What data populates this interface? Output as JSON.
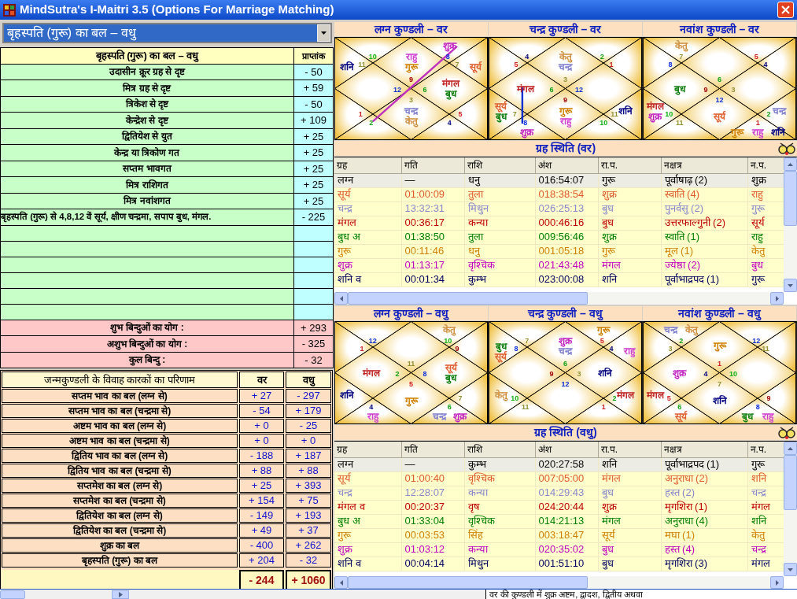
{
  "window": {
    "title": "MindSutra's I-Maitri 3.5 (Options For Marriage Matching)"
  },
  "selector": {
    "value": "बृहस्पति (गुरू) का बल – वधु"
  },
  "strength_table": {
    "title": "बृहस्पति (गुरू) का बल – वधु",
    "value_header": "प्राप्तांक",
    "rows": [
      {
        "kind": "score",
        "label": "उदासीन क्रूर ग्रह से दृष्ट",
        "value": "- 50"
      },
      {
        "kind": "score",
        "label": "मित्र ग्रह से दृष्ट",
        "value": "+ 59"
      },
      {
        "kind": "score",
        "label": "त्रिकेश से दृष्ट",
        "value": "- 50"
      },
      {
        "kind": "score",
        "label": "केन्द्रेश से दृष्ट",
        "value": "+ 109"
      },
      {
        "kind": "score",
        "label": "द्वितियेश से युत",
        "value": "+ 25"
      },
      {
        "kind": "score",
        "label": "केन्द्र या त्रिकोण गत",
        "value": "+ 25"
      },
      {
        "kind": "score",
        "label": "सप्तम भावगत",
        "value": "+ 25"
      },
      {
        "kind": "score",
        "label": "मित्र राशिगत",
        "value": "+ 25"
      },
      {
        "kind": "score",
        "label": "मित्र नवांशगत",
        "value": "+ 25"
      },
      {
        "kind": "score",
        "label": "बृहस्पति (गुरू) से 4,8,12 वें सूर्य, क्षीण चन्द्रमा, सपाप बुध, मंगल.",
        "value": "- 225"
      },
      {
        "kind": "blank"
      },
      {
        "kind": "blank"
      },
      {
        "kind": "blank"
      },
      {
        "kind": "blank"
      },
      {
        "kind": "blank"
      },
      {
        "kind": "blank"
      },
      {
        "kind": "summary",
        "label": "शुभ बिन्दुओं का योग :",
        "value": "+ 293"
      },
      {
        "kind": "summary",
        "label": "अशुभ बिन्दुओं का योग :",
        "value": "- 325"
      },
      {
        "kind": "summary",
        "label": "कुल बिन्दु :",
        "value": "- 32"
      }
    ]
  },
  "result_table": {
    "columns": [
      "जन्मकुण्डली के विवाह कारकों का परिणाम",
      "वर",
      "वधु"
    ],
    "rows": [
      {
        "label": "सप्तम भाव का बल (लग्न से)",
        "var": "+ 27",
        "vadhu": "- 297"
      },
      {
        "label": "सप्तम भाव का बल (चन्द्रमा से)",
        "var": "- 54",
        "vadhu": "+ 179"
      },
      {
        "label": "अष्टम भाव का बल (लग्न से)",
        "var": "+ 0",
        "vadhu": "- 25"
      },
      {
        "label": "अष्टम भाव का बल (चन्द्रमा से)",
        "var": "+ 0",
        "vadhu": "+ 0"
      },
      {
        "label": "द्वितिय भाव का बल (लग्न से)",
        "var": "- 188",
        "vadhu": "+ 187"
      },
      {
        "label": "द्वितिय भाव का बल (चन्द्रमा से)",
        "var": "+ 88",
        "vadhu": "+ 88"
      },
      {
        "label": "सप्तमेश का बल (लग्न से)",
        "var": "+ 25",
        "vadhu": "+ 393"
      },
      {
        "label": "सप्तमेश का बल (चन्द्रमा से)",
        "var": "+ 154",
        "vadhu": "+ 75"
      },
      {
        "label": "द्वितियेश का बल (लग्न से)",
        "var": "- 149",
        "vadhu": "+ 193"
      },
      {
        "label": "द्वितियेश का बल (चन्द्रमा से)",
        "var": "+ 49",
        "vadhu": "+ 37"
      },
      {
        "label": "शुक्र का बल",
        "var": "- 400",
        "vadhu": "+ 262"
      },
      {
        "label": "बृहस्पति (गुरू) का बल",
        "var": "+ 204",
        "vadhu": "- 32"
      }
    ],
    "totals": [
      "- 244",
      "+ 1060"
    ]
  },
  "var": {
    "charts": [
      {
        "title": "लग्न कुण्डली – वर",
        "aspect_line": {
          "color": "#c030c0"
        },
        "houses": {
          "top_left": {
            "sign": "10"
          },
          "top_right": {
            "sign": "8",
            "planets": [
              {
                "name": "शुक्र",
                "color": "#c020c0"
              }
            ]
          },
          "top": {
            "sign": "9",
            "planets": [
              {
                "name": "राहु",
                "color": "#d040d0"
              },
              {
                "name": "गुरू",
                "color": "#d08000"
              }
            ]
          },
          "left_top": {
            "sign": "11",
            "planets": [
              {
                "name": "शनि",
                "color": "#000080"
              }
            ]
          },
          "right_top": {
            "sign": "7",
            "planets": [
              {
                "name": "सूर्य",
                "color": "#e06030"
              }
            ]
          },
          "left": {
            "sign": "12"
          },
          "right": {
            "sign": "6",
            "planets": [
              {
                "name": "मंगल",
                "color": "#c02020"
              },
              {
                "name": "बुध",
                "color": "#108010"
              }
            ]
          },
          "left_bottom": {
            "sign": "1"
          },
          "right_bottom": {
            "sign": "5"
          },
          "bottom": {
            "sign": "3",
            "planets": [
              {
                "name": "चन्द्र",
                "color": "#8080d0"
              },
              {
                "name": "केतु",
                "color": "#d09040"
              }
            ]
          },
          "bottom_left": {
            "sign": "2"
          },
          "bottom_right": {
            "sign": "4"
          }
        }
      },
      {
        "title": "चन्द्र कुण्डली – वर",
        "aspect_line": {
          "color": "#1030d0"
        },
        "houses": {
          "top_left": {
            "sign": "4"
          },
          "top_right": {
            "sign": "2"
          },
          "top": {
            "sign": "3",
            "planets": [
              {
                "name": "केतु",
                "color": "#d09040"
              },
              {
                "name": "चन्द्र",
                "color": "#8080d0"
              }
            ]
          },
          "left_top": {
            "sign": "5"
          },
          "right_top": {
            "sign": "1"
          },
          "left": {
            "sign": "6",
            "planets": [
              {
                "name": "मंगल",
                "color": "#c02020"
              }
            ]
          },
          "right": {
            "sign": "12"
          },
          "left_bottom": {
            "sign": "7",
            "planets": [
              {
                "name": "सूर्य",
                "color": "#e06030"
              },
              {
                "name": "बुध",
                "color": "#108010"
              }
            ]
          },
          "right_bottom": {
            "sign": "11",
            "planets": [
              {
                "name": "शनि",
                "color": "#000080"
              }
            ]
          },
          "bottom": {
            "sign": "9",
            "planets": [
              {
                "name": "गुरू",
                "color": "#d08000"
              },
              {
                "name": "राहु",
                "color": "#d040d0"
              }
            ]
          },
          "bottom_left": {
            "sign": "8",
            "planets": [
              {
                "name": "शुक्र",
                "color": "#c020c0"
              }
            ]
          },
          "bottom_right": {
            "sign": "10"
          }
        }
      },
      {
        "title": "नवांश कुण्डली – वर",
        "houses": {
          "top_left": {
            "sign": "7",
            "planets": [
              {
                "name": "केतु",
                "color": "#d09040"
              }
            ]
          },
          "top_right": {
            "sign": "5"
          },
          "top": {
            "sign": "6"
          },
          "left_top": {
            "sign": "8"
          },
          "right_top": {
            "sign": "4"
          },
          "left": {
            "sign": "9",
            "planets": [
              {
                "name": "बुध",
                "color": "#108010"
              }
            ]
          },
          "right": {
            "sign": "3"
          },
          "left_bottom": {
            "sign": "10",
            "planets": [
              {
                "name": "मंगल",
                "color": "#c02020"
              },
              {
                "name": "शुक्र",
                "color": "#c020c0"
              }
            ]
          },
          "right_bottom": {
            "sign": "2",
            "planets": [
              {
                "name": "चन्द्र",
                "color": "#8080d0"
              }
            ]
          },
          "bottom": {
            "sign": "12",
            "planets": [
              {
                "name": "सूर्य",
                "color": "#e06030"
              }
            ]
          },
          "bottom_left": {
            "sign": "11"
          },
          "bottom_right": {
            "sign": "1",
            "planets": [
              {
                "name": "गुरू",
                "color": "#d08000"
              },
              {
                "name": "राहु",
                "color": "#d040d0"
              },
              {
                "name": "शनि",
                "color": "#000080"
              }
            ]
          }
        }
      }
    ],
    "positions": {
      "title": "ग्रह स्थिति (वर)",
      "columns": [
        "ग्रह",
        "गति",
        "राशि",
        "अंश",
        "रा.प.",
        "नक्षत्र",
        "न.प."
      ],
      "rows": [
        {
          "kind": "lagna",
          "color": "#000000",
          "cells": [
            "लग्न",
            "—",
            "धनु",
            "016:54:07",
            "गुरू",
            "पूर्वाषाढ़ (2)",
            "शुक्र"
          ]
        },
        {
          "kind": "planet",
          "color": "#e05a2a",
          "cells": [
            "सूर्य",
            "01:00:09",
            "तुला",
            "018:38:54",
            "शुक्र",
            "स्वाति (4)",
            "राहु"
          ]
        },
        {
          "kind": "planet",
          "color": "#8888cc",
          "cells": [
            "चन्द्र",
            "13:32:31",
            "मिथुन",
            "026:25:13",
            "बुध",
            "पुनर्वसु (2)",
            "गुरू"
          ]
        },
        {
          "kind": "planet",
          "color": "#c00000",
          "cells": [
            "मंगल",
            "00:36:17",
            "कन्या",
            "000:46:16",
            "बुध",
            "उत्तरफाल्गुनी (2)",
            "सूर्य"
          ]
        },
        {
          "kind": "planet",
          "color": "#008000",
          "cells": [
            "बुध अ",
            "01:38:50",
            "तुला",
            "009:56:46",
            "शुक्र",
            "स्वाति (1)",
            "राहु"
          ]
        },
        {
          "kind": "planet",
          "color": "#d08000",
          "cells": [
            "गुरू",
            "00:11:46",
            "धनु",
            "001:05:18",
            "गुरू",
            "मूल (1)",
            "केतु"
          ]
        },
        {
          "kind": "planet",
          "color": "#c000c0",
          "cells": [
            "शुक्र",
            "01:13:17",
            "वृश्चिक",
            "021:43:48",
            "मंगल",
            "ज्येष्ठा (2)",
            "बुध"
          ]
        },
        {
          "kind": "planet",
          "color": "#000060",
          "cells": [
            "शनि व",
            "00:01:34",
            "कुम्भ",
            "023:00:08",
            "शनि",
            "पूर्वाभाद्रपद (1)",
            "गुरू"
          ]
        }
      ]
    }
  },
  "vadhu": {
    "charts": [
      {
        "title": "लग्न कुण्डली – वधु",
        "houses": {
          "top_left": {
            "sign": "12"
          },
          "top_right": {
            "sign": "10",
            "planets": [
              {
                "name": "केतु",
                "color": "#d09040"
              }
            ]
          },
          "top": {
            "sign": "11"
          },
          "left_top": {
            "sign": "1"
          },
          "right_top": {
            "sign": "9"
          },
          "left": {
            "sign": "2",
            "planets": [
              {
                "name": "मंगल",
                "color": "#c02020"
              }
            ]
          },
          "right": {
            "sign": "8",
            "planets": [
              {
                "name": "सूर्य",
                "color": "#e06030"
              },
              {
                "name": "बुध",
                "color": "#108010"
              }
            ]
          },
          "left_bottom": {
            "planets": [
              {
                "name": "शनि",
                "color": "#000080"
              }
            ]
          },
          "right_bottom": {
            "sign": "7"
          },
          "bottom": {
            "sign": "5",
            "planets": [
              {
                "name": "गुरू",
                "color": "#d08000"
              }
            ]
          },
          "bottom_left": {
            "sign": "4",
            "planets": [
              {
                "name": "राहु",
                "color": "#d040d0"
              }
            ]
          },
          "bottom_right": {
            "sign": "6",
            "planets": [
              {
                "name": "चन्द्र",
                "color": "#8080d0"
              },
              {
                "name": "शुक्र",
                "color": "#c020c0"
              }
            ]
          }
        }
      },
      {
        "title": "चन्द्र कुण्डली – वधु",
        "houses": {
          "top_left": {
            "sign": "7"
          },
          "top_right": {
            "sign": "5",
            "planets": [
              {
                "name": "गुरू",
                "color": "#d08000"
              }
            ]
          },
          "top": {
            "sign": "6",
            "planets": [
              {
                "name": "शुक्र",
                "color": "#c020c0"
              },
              {
                "name": "चन्द्र",
                "color": "#8080d0"
              }
            ]
          },
          "left_top": {
            "sign": "8",
            "planets": [
              {
                "name": "बुध",
                "color": "#108010"
              },
              {
                "name": "सूर्य",
                "color": "#e06030"
              }
            ]
          },
          "right_top": {
            "sign": "4",
            "planets": [
              {
                "name": "राहु",
                "color": "#d040d0"
              }
            ]
          },
          "left": {
            "sign": "9"
          },
          "right": {
            "sign": "3",
            "planets": [
              {
                "name": "शनि",
                "color": "#000080"
              }
            ]
          },
          "left_bottom": {
            "sign": "10",
            "planets": [
              {
                "name": "केतु",
                "color": "#d09040"
              }
            ]
          },
          "right_bottom": {
            "sign": "2",
            "planets": [
              {
                "name": "मंगल",
                "color": "#c02020"
              }
            ]
          },
          "bottom": {
            "sign": "12"
          },
          "bottom_left": {
            "sign": "11"
          },
          "bottom_right": {
            "sign": "1"
          }
        }
      },
      {
        "title": "नवांश कुण्डली – वधु",
        "houses": {
          "top_left": {
            "sign": "2",
            "planets": [
              {
                "name": "चन्द्र",
                "color": "#8080d0"
              },
              {
                "name": "केतु",
                "color": "#d09040"
              }
            ]
          },
          "top_right": {
            "sign": "12"
          },
          "top": {
            "sign": "1",
            "planets": [
              {
                "name": "गुरू",
                "color": "#d08000"
              }
            ]
          },
          "left_top": {
            "sign": "3"
          },
          "right_top": {
            "sign": "11"
          },
          "left": {
            "sign": "4",
            "planets": [
              {
                "name": "शुक्र",
                "color": "#c020c0"
              }
            ]
          },
          "right": {
            "sign": "10"
          },
          "left_bottom": {
            "sign": "5",
            "planets": [
              {
                "name": "मंगल",
                "color": "#c02020"
              }
            ]
          },
          "right_bottom": {
            "sign": "9"
          },
          "bottom": {
            "sign": "7",
            "planets": [
              {
                "name": "शनि",
                "color": "#000080"
              }
            ]
          },
          "bottom_left": {
            "sign": "6",
            "planets": [
              {
                "name": "सूर्य",
                "color": "#e06030"
              }
            ]
          },
          "bottom_right": {
            "sign": "8",
            "planets": [
              {
                "name": "बुध",
                "color": "#108010"
              },
              {
                "name": "राहु",
                "color": "#d040d0"
              }
            ]
          }
        }
      }
    ],
    "positions": {
      "title": "ग्रह स्थिति (वधु)",
      "columns": [
        "ग्रह",
        "गति",
        "राशि",
        "अंश",
        "रा.प.",
        "नक्षत्र",
        "न.प."
      ],
      "rows": [
        {
          "kind": "lagna",
          "color": "#000000",
          "cells": [
            "लग्न",
            "—",
            "कुम्भ",
            "020:27:58",
            "शनि",
            "पूर्वाभाद्रपद (1)",
            "गुरू"
          ]
        },
        {
          "kind": "planet",
          "color": "#e05a2a",
          "cells": [
            "सूर्य",
            "01:00:40",
            "वृश्चिक",
            "007:05:00",
            "मंगल",
            "अनुराधा (2)",
            "शनि"
          ]
        },
        {
          "kind": "planet",
          "color": "#8888cc",
          "cells": [
            "चन्द्र",
            "12:28:07",
            "कन्या",
            "014:29:43",
            "बुध",
            "हस्त (2)",
            "चन्द्र"
          ]
        },
        {
          "kind": "planet",
          "color": "#c00000",
          "cells": [
            "मंगल व",
            "00:20:37",
            "वृष",
            "024:20:44",
            "शुक्र",
            "मृगशिरा (1)",
            "मंगल"
          ]
        },
        {
          "kind": "planet",
          "color": "#008000",
          "cells": [
            "बुध अ",
            "01:33:04",
            "वृश्चिक",
            "014:21:13",
            "मंगल",
            "अनुराधा (4)",
            "शनि"
          ]
        },
        {
          "kind": "planet",
          "color": "#d08000",
          "cells": [
            "गुरू",
            "00:03:53",
            "सिंह",
            "003:18:47",
            "सूर्य",
            "मघा (1)",
            "केतु"
          ]
        },
        {
          "kind": "planet",
          "color": "#c000c0",
          "cells": [
            "शुक्र",
            "01:03:12",
            "कन्या",
            "020:35:02",
            "बुध",
            "हस्त (4)",
            "चन्द्र"
          ]
        },
        {
          "kind": "planet",
          "color": "#000060",
          "cells": [
            "शनि व",
            "00:04:14",
            "मिथुन",
            "001:51:10",
            "बुध",
            "मृगशिरा (3)",
            "मंगल"
          ]
        }
      ]
    }
  },
  "status_text": "वर की कुण्डली में शुक्र अष्टम, द्वादश, द्वितीय अथवा"
}
